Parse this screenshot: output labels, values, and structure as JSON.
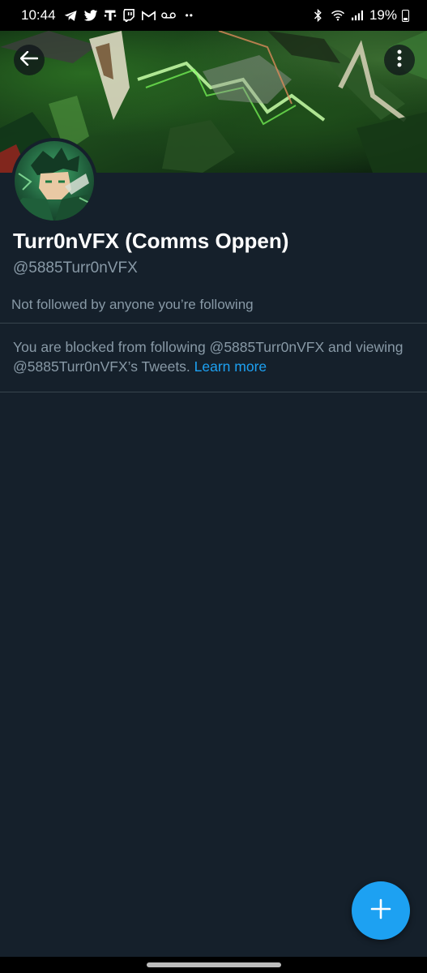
{
  "status_bar": {
    "time": "10:44",
    "battery_percent": "19%",
    "left_icons": [
      "telegram-icon",
      "twitter-icon",
      "t-mobile-icon",
      "twitch-icon",
      "gmail-icon",
      "voicemail-icon",
      "more-notifications-icon"
    ],
    "right_icons": [
      "bluetooth-icon",
      "wifi-icon",
      "signal-icon",
      "battery-icon"
    ],
    "battery_level": 0.19
  },
  "header": {
    "back_icon": "arrow-left-icon",
    "more_icon": "more-vertical-icon"
  },
  "profile": {
    "display_name": "Turr0nVFX (Comms Oppen)",
    "handle": "@5885Turr0nVFX",
    "followers_note": "Not followed by anyone you’re following"
  },
  "blocked_notice": {
    "text": "You are blocked from following @5885Turr0nVFX and viewing @5885Turr0nVFX’s Tweets. ",
    "link": "Learn more"
  },
  "fab": {
    "icon": "plus-icon"
  },
  "colors": {
    "background": "#15202b",
    "accent": "#1da1f2",
    "secondary_text": "#8899a6",
    "divider": "#38444d"
  }
}
